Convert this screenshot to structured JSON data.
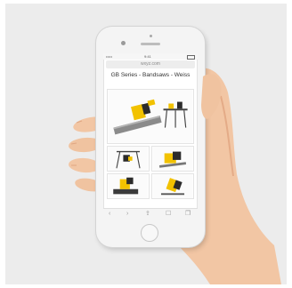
{
  "browser": {
    "status_signal": "•••••",
    "status_time": "9:41",
    "url": "wxyz.com",
    "page_title": "GB Series - Bandsaws - Weiss"
  },
  "toolbar": {
    "back_icon": "‹",
    "forward_icon": "›",
    "share_icon": "⇪",
    "bookmarks_icon": "☐",
    "tabs_icon": "❐"
  },
  "gallery": {
    "hero": "bandsaw-on-pipe",
    "thumbnails": [
      "bandsaw-on-stand",
      "bandsaw-close-up",
      "bandsaw-on-bench",
      "bandsaw-angled"
    ]
  },
  "colors": {
    "background": "#ececec",
    "skin": "#f2c6a4",
    "phone_body": "#f4f4f4",
    "machine_yellow": "#f2c200",
    "machine_dark": "#2b2b2b"
  }
}
